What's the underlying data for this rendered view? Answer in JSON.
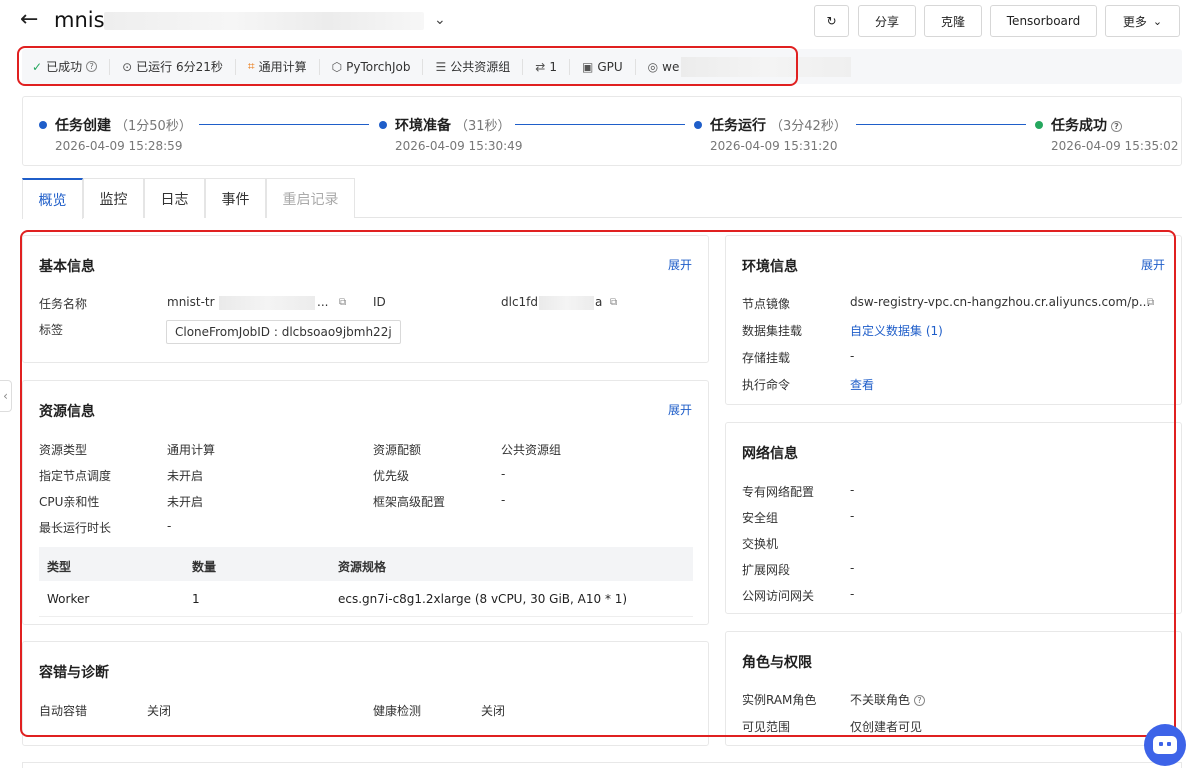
{
  "header": {
    "title": "mnis",
    "buttons": {
      "refresh": "↻",
      "share": "分享",
      "clone": "克隆",
      "tensorboard": "Tensorboard",
      "more": "更多"
    }
  },
  "status_bar": {
    "status": "已成功",
    "runtime": "已运行 6分21秒",
    "compute": "通用计算",
    "framework": "PyTorchJob",
    "resource_group": "公共资源组",
    "nodes": "1",
    "gpu": "GPU",
    "user": "we"
  },
  "timeline": [
    {
      "name": "任务创建",
      "duration": "（1分50秒）",
      "time": "2026-04-09 15:28:59"
    },
    {
      "name": "环境准备",
      "duration": "（31秒）",
      "time": "2026-04-09 15:30:49"
    },
    {
      "name": "任务运行",
      "duration": "（3分42秒）",
      "time": "2026-04-09 15:31:20"
    },
    {
      "name": "任务成功",
      "duration": "",
      "time": "2026-04-09 15:35:02"
    }
  ],
  "tabs": [
    "概览",
    "监控",
    "日志",
    "事件",
    "重启记录"
  ],
  "expand_label": "展开",
  "basic_info": {
    "title": "基本信息",
    "task_name_label": "任务名称",
    "task_name_value": "mnist-tr",
    "task_name_suffix": "...",
    "id_label": "ID",
    "id_value_prefix": "dlc1fd",
    "id_value_suffix": "a",
    "tag_label": "标签",
    "tag_value": "CloneFromJobID : dlcbsoao9jbmh22j"
  },
  "resource_info": {
    "title": "资源信息",
    "fields": [
      {
        "label": "资源类型",
        "value": "通用计算"
      },
      {
        "label": "资源配额",
        "value": "公共资源组"
      },
      {
        "label": "指定节点调度",
        "value": "未开启"
      },
      {
        "label": "优先级",
        "value": "-"
      },
      {
        "label": "CPU亲和性",
        "value": "未开启"
      },
      {
        "label": "框架高级配置",
        "value": "-"
      },
      {
        "label": "最长运行时长",
        "value": "-"
      }
    ],
    "table": {
      "headers": [
        "类型",
        "数量",
        "资源规格"
      ],
      "rows": [
        [
          "Worker",
          "1",
          "ecs.gn7i-c8g1.2xlarge (8 vCPU, 30 GiB, A10 * 1)"
        ]
      ]
    }
  },
  "fault_tolerance": {
    "title": "容错与诊断",
    "auto_label": "自动容错",
    "auto_value": "关闭",
    "health_label": "健康检测",
    "health_value": "关闭"
  },
  "env_info": {
    "title": "环境信息",
    "image_label": "节点镜像",
    "image_value": "dsw-registry-vpc.cn-hangzhou.cr.aliyuncs.com/p...",
    "dataset_label": "数据集挂载",
    "dataset_value": "自定义数据集 (1)",
    "storage_label": "存储挂载",
    "storage_value": "-",
    "cmd_label": "执行命令",
    "cmd_value": "查看"
  },
  "network_info": {
    "title": "网络信息",
    "fields": [
      {
        "label": "专有网络配置",
        "value": "-"
      },
      {
        "label": "安全组",
        "value": "-"
      },
      {
        "label": "交换机",
        "value": ""
      },
      {
        "label": "扩展网段",
        "value": "-"
      },
      {
        "label": "公网访问网关",
        "value": "-"
      }
    ]
  },
  "role_info": {
    "title": "角色与权限",
    "ram_label": "实例RAM角色",
    "ram_value": "不关联角色",
    "scope_label": "可见范围",
    "scope_value": "仅创建者可见"
  },
  "icons": {
    "back": "arrow-left-icon",
    "check": "check-icon",
    "clock": "play-circle-icon",
    "compute": "compute-icon",
    "pytorch": "pytorch-icon",
    "resource": "database-icon",
    "node": "nodes-icon",
    "gpu": "chip-icon",
    "user": "user-icon"
  },
  "colors": {
    "accent": "#1f5ec9",
    "success": "#25a75e",
    "highlight": "#e02020"
  }
}
